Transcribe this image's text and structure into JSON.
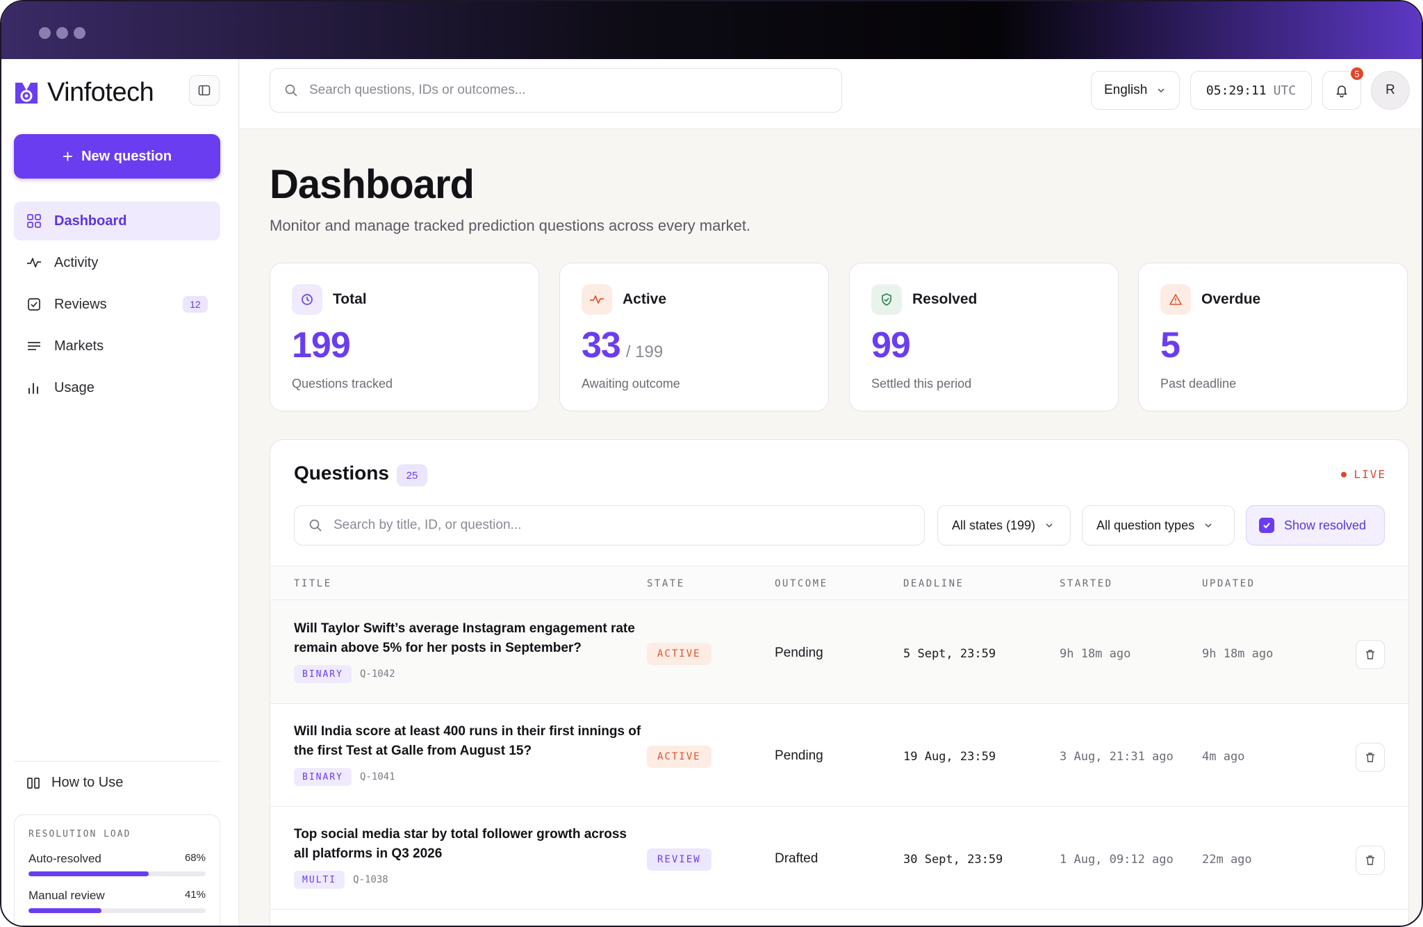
{
  "brand": {
    "name": "Vinfotech"
  },
  "sidebar": {
    "new_question_label": "New question",
    "items": [
      {
        "label": "Dashboard",
        "icon": "grid-icon",
        "active": true
      },
      {
        "label": "Activity",
        "icon": "pulse-icon"
      },
      {
        "label": "Reviews",
        "icon": "checkbox-icon",
        "badge": "12"
      },
      {
        "label": "Markets",
        "icon": "list-icon"
      },
      {
        "label": "Usage",
        "icon": "bar-chart-icon"
      }
    ],
    "how_to_use": "How to Use",
    "resolution_load": {
      "title": "RESOLUTION LOAD",
      "rows": [
        {
          "label": "Auto-resolved",
          "pct": "68%",
          "value": 68
        },
        {
          "label": "Manual review",
          "pct": "41%",
          "value": 41
        }
      ]
    }
  },
  "topbar": {
    "search_placeholder": "Search questions, IDs or outcomes...",
    "language": "English",
    "time": "05:29:11",
    "timezone": "UTC",
    "notifications": "5",
    "avatar_initial": "R"
  },
  "page": {
    "title": "Dashboard",
    "subtitle": "Monitor and manage tracked prediction questions across every market."
  },
  "stats": [
    {
      "label": "Total",
      "value": "199",
      "of": "",
      "caption": "Questions tracked",
      "icon": "clock-icon",
      "accent": "#6a3df0"
    },
    {
      "label": "Active",
      "value": "33",
      "of": "/ 199",
      "caption": "Awaiting outcome",
      "icon": "pulse-icon",
      "accent": "#e2542e"
    },
    {
      "label": "Resolved",
      "value": "99",
      "of": "",
      "caption": "Settled this period",
      "icon": "shield-check-icon",
      "accent": "#2f7a4f"
    },
    {
      "label": "Overdue",
      "value": "5",
      "of": "",
      "caption": "Past deadline",
      "icon": "warning-icon",
      "accent": "#d9542e"
    }
  ],
  "questions": {
    "title": "Questions",
    "count": "25",
    "live": "LIVE",
    "search_placeholder": "Search by title, ID, or question...",
    "filter_states": "All states (199)",
    "filter_types": "All question types",
    "show_resolved": "Show resolved",
    "columns": [
      "TITLE",
      "STATE",
      "OUTCOME",
      "DEADLINE",
      "STARTED",
      "UPDATED"
    ],
    "rows": [
      {
        "title": "Will Taylor Swift’s average Instagram engagement rate remain above 5% for her posts in September?",
        "type": "BINARY",
        "id": "Q-1042",
        "state": "ACTIVE",
        "outcome": "Pending",
        "deadline": "5 Sept, 23:59",
        "started": "9h 18m ago",
        "updated": "9h 18m ago"
      },
      {
        "title": "Will India score at least 400 runs in their first innings of the first Test at Galle from August 15?",
        "type": "BINARY",
        "id": "Q-1041",
        "state": "ACTIVE",
        "outcome": "Pending",
        "deadline": "19 Aug, 23:59",
        "started": "3 Aug, 21:31 ago",
        "updated": "4m ago"
      },
      {
        "title": "Top social media star by total follower growth across all platforms in Q3 2026",
        "type": "MULTI",
        "id": "Q-1038",
        "state": "REVIEW",
        "outcome": "Drafted",
        "deadline": "30 Sept, 23:59",
        "started": "1 Aug, 09:12 ago",
        "updated": "22m ago"
      }
    ]
  }
}
